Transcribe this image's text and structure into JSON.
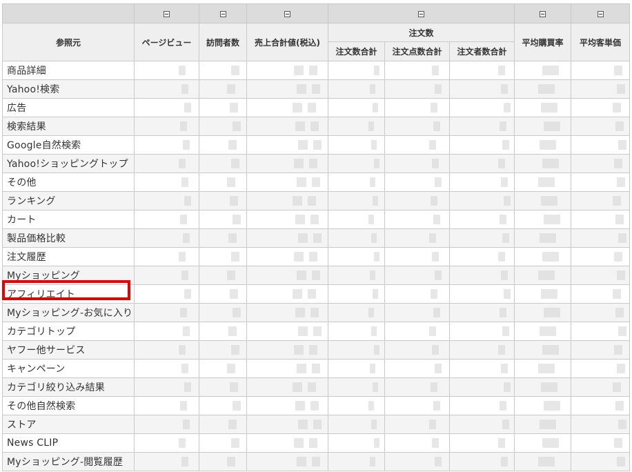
{
  "table": {
    "header": {
      "referrer": "参照元",
      "pageviews": "ページビュー",
      "visitors": "訪問者数",
      "sales_total": "売上合計値(税込)",
      "orders_group": "注文数",
      "orders_total": "注文数合計",
      "order_items_total": "注文点数合計",
      "orderers_total": "注文者数合計",
      "avg_purchase_rate": "平均購買率",
      "avg_customer_price": "平均客単価"
    },
    "rows": [
      "商品詳細",
      "Yahoo!検索",
      "広告",
      "検索結果",
      "Google自然検索",
      "Yahoo!ショッピングトップ",
      "その他",
      "ランキング",
      "カート",
      "製品価格比較",
      "注文履歴",
      "Myショッピング",
      "アフィリエイト",
      "Myショッピング-お気に入り",
      "カテゴリトップ",
      "ヤフー他サービス",
      "キャンペーン",
      "カテゴリ絞り込み結果",
      "その他自然検索",
      "ストア",
      "News CLIP",
      "Myショッピング-閲覧履歴"
    ],
    "highlighted_row": "アフィリエイト"
  }
}
